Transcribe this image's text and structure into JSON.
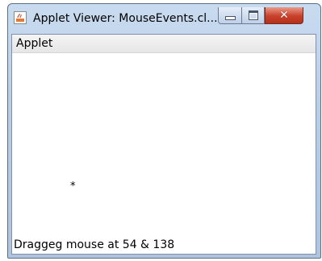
{
  "window": {
    "title": "Applet Viewer: MouseEvents.cl...",
    "icon": "java-applet-icon",
    "controls": {
      "minimize": "minimize-icon",
      "maximize": "maximize-icon",
      "close": "close-icon",
      "close_glyph": "✕"
    }
  },
  "menubar": {
    "items": [
      {
        "label": "Applet"
      }
    ]
  },
  "canvas": {
    "marker": "*"
  },
  "status": {
    "text": "Draggeg mouse at 54 & 138"
  }
}
